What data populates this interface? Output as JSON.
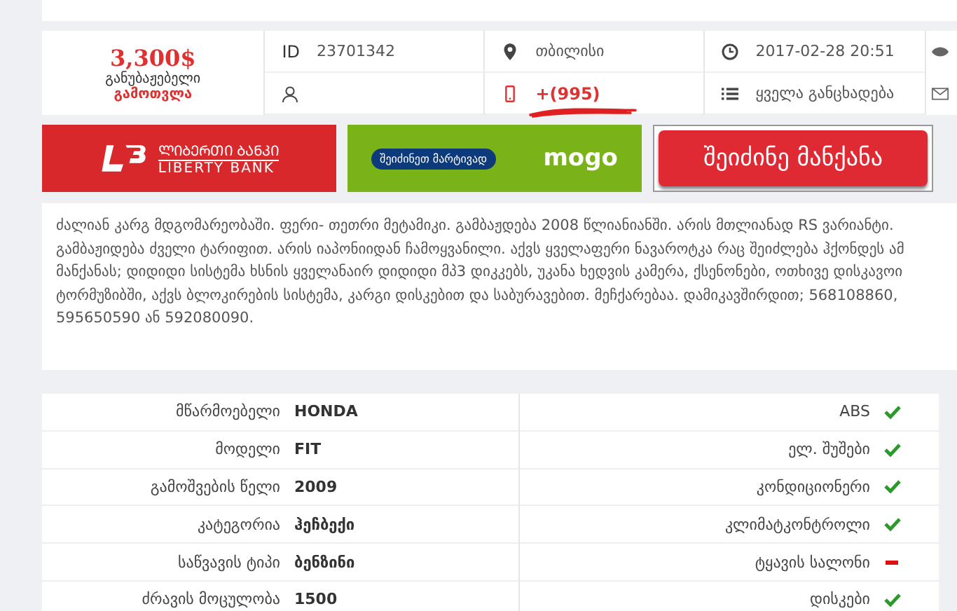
{
  "price": {
    "amount": "3,300$",
    "note": "განუბაჟებელი",
    "calc": "გამოთვლა"
  },
  "info": [
    {
      "kind": "id",
      "label": "ID",
      "value": "23701342"
    },
    {
      "kind": "location",
      "value": "თბილისი"
    },
    {
      "kind": "date",
      "value": "2017-02-28 20:51"
    },
    {
      "kind": "user"
    },
    {
      "kind": "phone",
      "value": "+(995)"
    },
    {
      "kind": "list",
      "value": "ყველა განცხადება"
    }
  ],
  "banners": {
    "liberty": {
      "line1": "ᲚᲘᲑᲔᲠᲗᲘ ᲑᲐᲜᲙᲘ",
      "line2": "LIBERTY BANK"
    },
    "mogo": {
      "pill": "შეიძინეთ მარტივად",
      "brand": "mogo"
    },
    "buy_button": "შეიძინე მანქანა"
  },
  "description": "ძალიან კარგ მდგომარეობაში. ფერი- თეთრი მეტამიკი. გამბაჟდება 2008 წლიანიანში. არის მთლიანად RS ვარიანტი. გამბაჟიდება ძველი ტარიფით. არის იაპონიიდან ჩამოყვანილი. აქვს ყველაფერი ნავაროტკა რაც შეიძლება ჰქონდეს ამ მანქანას; დიდიდი სისტემა ხსნის ყველანაირ დიდიდი მპ3 დიკკებს, უკანა ხედვის კამერა, ქსენონები, ოთხივე დისკავოი ტორმუზიბში, აქვს ბლოკირების სისტემა, კარგი დისკებით და საბურავებით. მეჩქარებაა. დამიკავშირდით; 568108860, 595650590 ან 592080090.",
  "specs": [
    {
      "label": "მწარმოებელი",
      "value": "HONDA"
    },
    {
      "label": "მოდელი",
      "value": "FIT"
    },
    {
      "label": "გამოშვების წელი",
      "value": "2009"
    },
    {
      "label": "კატეგორია",
      "value": "ჰეჩბექი"
    },
    {
      "label": "საწვავის ტიპი",
      "value": "ბენზინი"
    },
    {
      "label": "ძრავის მოცულობა",
      "value": "1500"
    }
  ],
  "features": [
    {
      "label": "ABS",
      "available": true
    },
    {
      "label": "ელ. შუშები",
      "available": true
    },
    {
      "label": "კონდიციონერი",
      "available": true
    },
    {
      "label": "კლიმატკონტროლი",
      "available": true
    },
    {
      "label": "ტყავის სალონი",
      "available": false
    },
    {
      "label": "დისკები",
      "available": true
    }
  ]
}
